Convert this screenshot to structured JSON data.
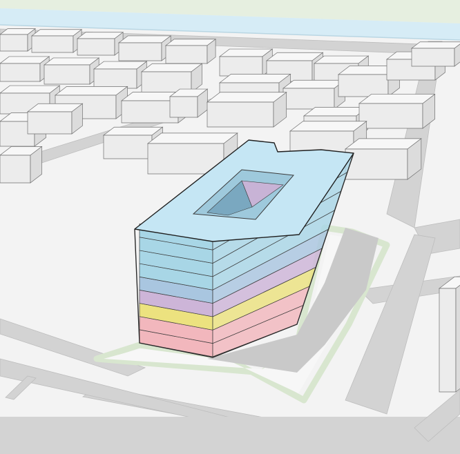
{
  "scene": {
    "kind": "3d-massing-model",
    "colors": {
      "ground": "#f3f3f3",
      "road": "#d3d3d3",
      "road_edge": "#bdbdbd",
      "water": "#d6ecf6",
      "park_top": "#e6efe0",
      "site_outline": "#d8e6cf",
      "context_building_top": "#f7f7f7",
      "context_building_front": "#ececec",
      "context_building_side": "#dcdcdc",
      "floor_band_pink": "#f2b7bd",
      "floor_band_yellow": "#ece27f",
      "floor_band_lavender": "#cdb5d8",
      "floor_band_blue": "#a9c6e0",
      "floor_band_sky": "#a8d6e6",
      "roof": "#c5e6f4"
    },
    "massing": {
      "floor_count": 9,
      "floor_color_keys": [
        "floor_band_pink",
        "floor_band_pink",
        "floor_band_yellow",
        "floor_band_lavender",
        "floor_band_blue",
        "floor_band_sky",
        "floor_band_sky",
        "floor_band_sky",
        "floor_band_sky"
      ],
      "has_courtyard": true
    }
  }
}
